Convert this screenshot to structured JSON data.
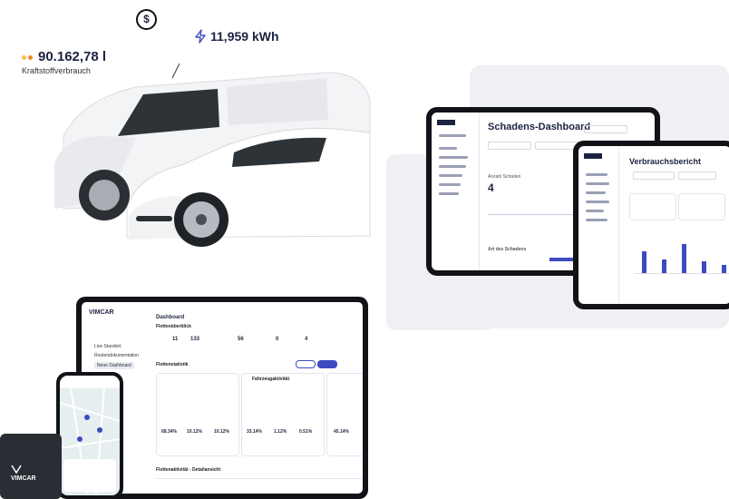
{
  "stats": {
    "fuel_value": "90.162,78 l",
    "fuel_label": "Kraftstoffverbrauch",
    "energy_value": "11,959 kWh",
    "currency_symbol": "$"
  },
  "dashboard_tablet": {
    "title": "Schadens-Dashboard",
    "metric_label": "Anzahl Schäden",
    "metric_value": "4",
    "section_label": "Art des Schadens"
  },
  "consumption_tablet": {
    "title": "Verbrauchsbericht",
    "bars": [
      0.55,
      0.35,
      0.72,
      0.3,
      0.2
    ]
  },
  "fleet_tablet": {
    "logo": "VIMCAR",
    "nav": [
      "Live Standort",
      "Routendokumentation",
      "Neue Dashboard"
    ],
    "active_nav": 2,
    "title": "Dashboard",
    "overview_label": "Flottenüberblick",
    "kpis": [
      "11",
      "133",
      "56",
      "0",
      "4"
    ],
    "section": "Flottenstatistik",
    "section2": "Fahrzeugaktivität",
    "percentages": [
      "68.34%",
      "10.12%",
      "10.12%",
      "33.14%",
      "1.12%",
      "0.51%",
      "45.14%"
    ],
    "bottom_section": "Flottenaktivität - Detailansicht"
  },
  "obd_device": {
    "brand": "VIMCAR"
  },
  "colors": {
    "accent": "#3c4bc0",
    "dark": "#1c2240",
    "panel": "#eef0f4",
    "fuel_dots": [
      "#f9c04a",
      "#f08a2c"
    ]
  }
}
